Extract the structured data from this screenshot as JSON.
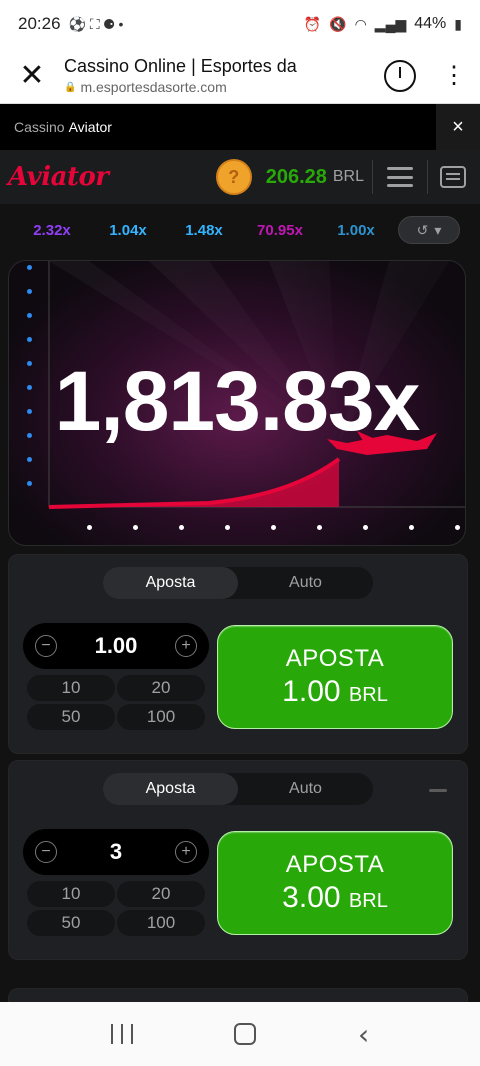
{
  "status": {
    "time": "20:26",
    "battery": "44%"
  },
  "browser": {
    "title": "Cassino Online | Esportes da",
    "url": "m.esportesdasorte.com"
  },
  "subheader": {
    "prefix": "Cassino",
    "game": "Aviator",
    "close": "×"
  },
  "game": {
    "logo": "Aviator",
    "coin": "?",
    "balance": "206.28",
    "currency": "BRL"
  },
  "history": [
    {
      "value": "2.32x",
      "color": "#913ef8"
    },
    {
      "value": "1.04x",
      "color": "#34b4ff"
    },
    {
      "value": "1.48x",
      "color": "#34b4ff"
    },
    {
      "value": "70.95x",
      "color": "#c017b4"
    },
    {
      "value": "1.00x",
      "color": "#34b4ff"
    }
  ],
  "round": {
    "multiplier": "1,813.83x"
  },
  "bets": [
    {
      "tabs": [
        "Aposta",
        "Auto"
      ],
      "active_tab": "Aposta",
      "stake": "1.00",
      "quick_amounts": [
        "10",
        "20",
        "50",
        "100"
      ],
      "button_label": "APOSTA",
      "button_amount": "1.00",
      "button_currency": "BRL"
    },
    {
      "tabs": [
        "Aposta",
        "Auto"
      ],
      "active_tab": "Aposta",
      "stake": "3",
      "quick_amounts": [
        "10",
        "20",
        "50",
        "100"
      ],
      "button_label": "APOSTA",
      "button_amount": "3.00",
      "button_currency": "BRL"
    }
  ],
  "colors": {
    "brand_red": "#e50539",
    "green": "#28a909",
    "axis_blue": "#2e8bf0"
  }
}
